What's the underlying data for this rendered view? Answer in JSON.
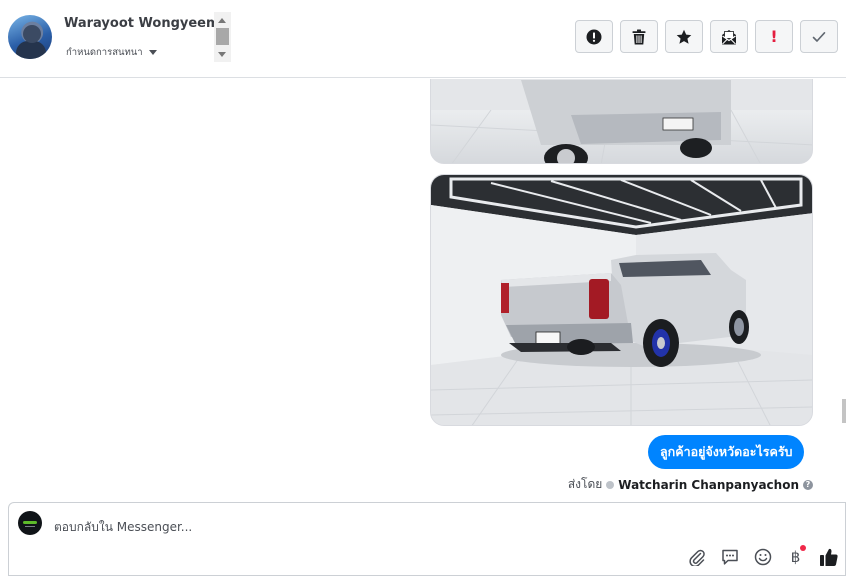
{
  "header": {
    "contact_name": "Warayoot Wongyeemor",
    "assign_label": "กำหนดการสนทนา"
  },
  "actions": [
    {
      "name": "mark-spam",
      "icon": "alert-circle-icon"
    },
    {
      "name": "delete",
      "icon": "trash-icon"
    },
    {
      "name": "star",
      "icon": "star-icon"
    },
    {
      "name": "mark-unread",
      "icon": "envelope-icon"
    },
    {
      "name": "important",
      "icon": "exclamation-icon",
      "glyph": "!"
    },
    {
      "name": "mark-done",
      "icon": "check-icon"
    }
  ],
  "conversation": {
    "message_text": "ลูกค้าอยู่จังหวัดอะไรครับ",
    "sent_by_label": "ส่งโดย",
    "sender_name": "Watcharin Chanpanyachon",
    "help_glyph": "?"
  },
  "composer": {
    "placeholder": "ตอบกลับใน Messenger...",
    "currency_glyph": "฿"
  },
  "colors": {
    "accent": "#0084ff",
    "important": "#e41e3f",
    "notification": "#f02849"
  }
}
